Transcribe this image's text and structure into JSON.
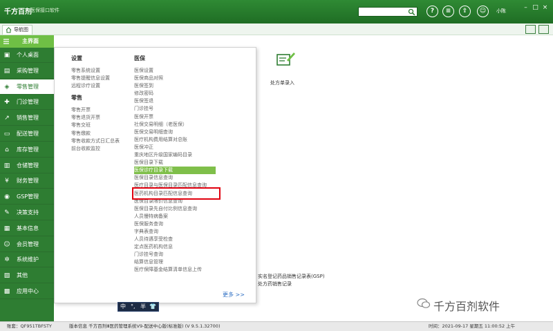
{
  "app": {
    "logo": "千方百剂",
    "subtitle": "医保接口软件",
    "user": "小陈"
  },
  "search": {
    "value": "",
    "placeholder": ""
  },
  "toolbar": {
    "buttons": [
      "?",
      "≡",
      "⇪",
      "☺"
    ]
  },
  "nav": {
    "tab_label": "导航图"
  },
  "sidebar": {
    "title": "主界面",
    "items": [
      {
        "icon": "monitor-icon",
        "glyph": "▣",
        "label": "个人桌面"
      },
      {
        "icon": "cart-icon",
        "glyph": "▤",
        "label": "采购管理"
      },
      {
        "icon": "tag-icon",
        "glyph": "◈",
        "label": "零售管理",
        "active": true
      },
      {
        "icon": "clinic-icon",
        "glyph": "✚",
        "label": "门诊管理"
      },
      {
        "icon": "chart-icon",
        "glyph": "↗",
        "label": "销售管理"
      },
      {
        "icon": "truck-icon",
        "glyph": "▭",
        "label": "配送管理"
      },
      {
        "icon": "warehouse-icon",
        "glyph": "⌂",
        "label": "库存管理"
      },
      {
        "icon": "storage-icon",
        "glyph": "▥",
        "label": "仓储管理"
      },
      {
        "icon": "yen-icon",
        "glyph": "¥",
        "label": "财务管理"
      },
      {
        "icon": "gsp-icon",
        "glyph": "◉",
        "label": "GSP管理"
      },
      {
        "icon": "decision-icon",
        "glyph": "✎",
        "label": "决策支持"
      },
      {
        "icon": "info-icon",
        "glyph": "▦",
        "label": "基本信息"
      },
      {
        "icon": "member-icon",
        "glyph": "☺",
        "label": "会员管理"
      },
      {
        "icon": "gear-icon",
        "glyph": "✲",
        "label": "系统维护"
      },
      {
        "icon": "other-icon",
        "glyph": "▨",
        "label": "其他"
      },
      {
        "icon": "apps-icon",
        "glyph": "▩",
        "label": "应用中心"
      }
    ]
  },
  "menu": {
    "settings": {
      "heading": "设置",
      "items": [
        "零售系统设置",
        "零售提醒信息设置",
        "远程诊疗设置"
      ]
    },
    "retail": {
      "heading": "零售",
      "items": [
        "零售开票",
        "零售退货开票",
        "零售交班",
        "零售缴款",
        "零售收款方式日汇总表",
        "前台收款监控"
      ]
    },
    "insurance": {
      "heading": "医保",
      "items": [
        "医保设置",
        "医保商品对照",
        "医保签到",
        "修改密码",
        "医保签退",
        "门诊挂号",
        "医保开票",
        "社保交易明细（老医保）",
        "医保交易明细查询",
        "医疗机构费用结算对总账",
        "医保冲正",
        "重庆地区升级国家编码目录",
        "医保目录下载",
        "医保诊疗目录下载",
        "医保目录信息查询",
        "医疗目录与医保目录匹配信息查询",
        "医药机构目录匹配信息查询",
        "医保目录限价信息查询",
        "医保目录先自付比例信息查询",
        "人员慢特病备案",
        "医保服务查询",
        "字典表查询",
        "人员待遇享受检查",
        "定点医药机构信息",
        "门诊挂号查询",
        "结算信息管理",
        "医疗保障基金结算清单信息上传"
      ],
      "highlighted_index": 13
    },
    "more": "更多 >>"
  },
  "right": {
    "rx_label": "处方单录入",
    "reports": [
      "实名登记药品销售记录表(GSP)",
      "处方药销售记录"
    ],
    "watermark": "千方百剂软件"
  },
  "ime": {
    "lang": "中",
    "dot": "°,",
    "half": "半",
    "shirt": "👕"
  },
  "status": {
    "account": "账套：QF951TBFSTY",
    "version": "版本信息  千方百剂Ⅲ医药管理系统V9-配送中心版(标准版)  (V 9.5.1.32700)",
    "time": "时间：2021-09-17 星期五 11:00:52 上午"
  },
  "colors": {
    "brand_green": "#2e7d32",
    "highlight_green": "#7fbf4a",
    "annotation_red": "#e0000e"
  }
}
